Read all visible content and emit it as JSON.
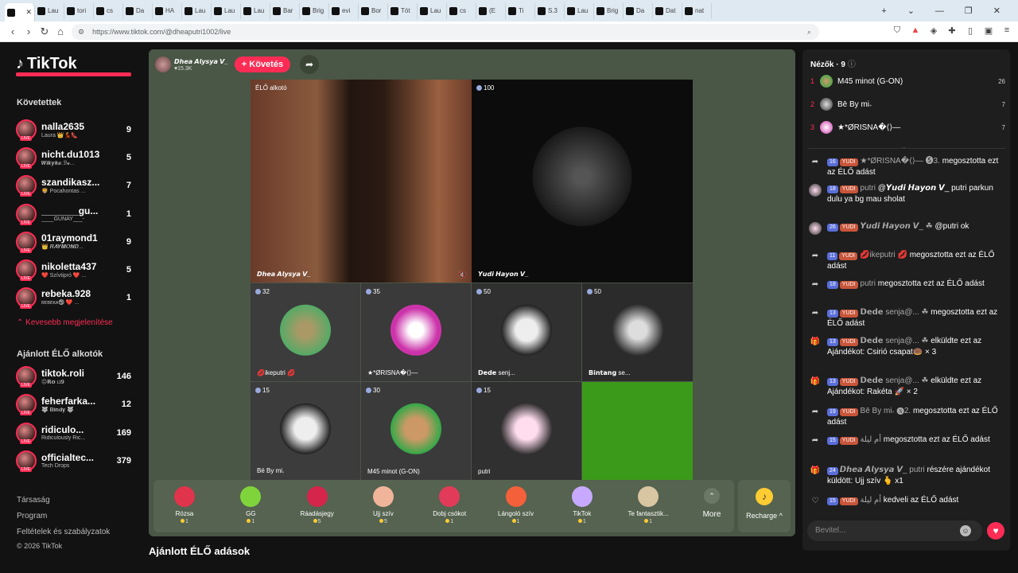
{
  "browser": {
    "tabs": [
      "",
      "Lau",
      "tori",
      "cs",
      "Da",
      "HA",
      "Lau",
      "Lau",
      "Lau",
      "Bar",
      "Brig",
      "evi",
      "Bor",
      "Tót",
      "Lau",
      "cs",
      "(E",
      "Ti",
      "S.3",
      "Lau",
      "Brig",
      "Da",
      "Dat",
      "nat"
    ],
    "url": "https://www.tiktok.com/@dheaputri1002/live"
  },
  "sidebar": {
    "logo": "TikTok",
    "following_title": "Követettek",
    "following": [
      {
        "name": "nalla2635",
        "sub": "Laura 👑💃👠",
        "count": "9"
      },
      {
        "name": "nicht.du1013",
        "sub": "𝑾𝒊𝒌𝒚𝒌𝒆.ℬ𝓮...",
        "count": "5"
      },
      {
        "name": "szandikasz...",
        "sub": "🦁 Pocahontas ...",
        "count": "7"
      },
      {
        "name": "_______gu...",
        "sub": "____GUNAY___-",
        "count": "1"
      },
      {
        "name": "01raymond1",
        "sub": "👑 𝑹𝑨𝒀𝑴𝑶𝑵𝑫...",
        "count": "9"
      },
      {
        "name": "nikoletta437",
        "sub": "❤️ Szívtipró ❤️ ...",
        "count": "5"
      },
      {
        "name": "rebeka.928",
        "sub": "ʀᴇʙᴇᴋᴀ🕲 ❤️ ...",
        "count": "1"
      }
    ],
    "show_less": "Kevesebb megjelenítése",
    "recommended_title": "Ajánlott ÉLŐ alkotók",
    "recommended": [
      {
        "name": "tiktok.roli",
        "sub": "😐𝗥𝗼 ʟɪ𝟗",
        "count": "146"
      },
      {
        "name": "feherfarka...",
        "sub": "🐺 𝐁𝐢𝐧𝐝𝐲 🐺",
        "count": "12"
      },
      {
        "name": "ridiculo...",
        "sub": "Ridiculously Ric...",
        "count": "169"
      },
      {
        "name": "officialtec...",
        "sub": "Tech Drops",
        "count": "379"
      }
    ],
    "footer": [
      "Társaság",
      "Program",
      "Feltételek és szabályzatok",
      "© 2026 TikTok"
    ]
  },
  "stage": {
    "host_name": "𝘿𝙝𝙚𝙖 𝘼𝙡𝙮𝙨𝙮𝙖 𝙑_",
    "host_likes": "♥15.3K",
    "follow_label": "+ Követés",
    "cells": [
      {
        "badge": "ÉLŐ alkotó",
        "name": "𝘿𝙝𝙚𝙖 𝘼𝙡𝙮𝙨𝙮𝙖 𝙑_"
      },
      {
        "badge": "100",
        "name": "𝙔𝙪𝙙𝙞 𝙃𝙖𝙮𝙤𝙣 𝙑_"
      },
      {
        "badge": "32",
        "name": "💋ikeputri 💋"
      },
      {
        "badge": "35",
        "name": "★*ØRISNA�⟨⟩—"
      },
      {
        "badge": "50",
        "name": "𝗗𝗲𝗱𝗲 senj..."
      },
      {
        "badge": "50",
        "name": "𝗕𝗶𝗻𝘁𝗮𝗻𝗴 se..."
      },
      {
        "badge": "15",
        "name": "Bē By mi𝆹"
      },
      {
        "badge": "30",
        "name": "M45 minot (G-ON)"
      },
      {
        "badge": "15",
        "name": "putri"
      },
      {
        "badge": "",
        "name": ""
      }
    ],
    "gifts": [
      {
        "name": "Rózsa",
        "price": "1",
        "icon": "rose-icon",
        "color": "#e0344c"
      },
      {
        "name": "GG",
        "price": "1",
        "icon": "gg-icon",
        "color": "#7fd43b"
      },
      {
        "name": "Ráadásjegy",
        "price": "5",
        "icon": "ticket-icon",
        "color": "#d5254b"
      },
      {
        "name": "Ujj szív",
        "price": "5",
        "icon": "finger-heart-icon",
        "color": "#f0b49a"
      },
      {
        "name": "Dobj csókot",
        "price": "1",
        "icon": "kiss-icon",
        "color": "#e23b5a"
      },
      {
        "name": "Lángoló szív",
        "price": "1",
        "icon": "flame-heart-icon",
        "color": "#f4603a"
      },
      {
        "name": "TikTok",
        "price": "1",
        "icon": "tiktok-icon",
        "color": "#c7a9ff"
      },
      {
        "name": "Te fantasztik...",
        "price": "1",
        "icon": "cat-icon",
        "color": "#d7c6a1"
      }
    ],
    "more_label": "More",
    "recharge_label": "Recharge ^"
  },
  "bottom_title": "Ajánlott ÉLŐ adások",
  "chat": {
    "viewers_title": "Nézők · 9",
    "viewers": [
      {
        "rank": "1",
        "name": "M45 minot (G-ON)",
        "count": "26"
      },
      {
        "rank": "2",
        "name": "Bē By mi𝆹",
        "count": "7"
      },
      {
        "rank": "3",
        "name": "★*ØRISNA�⟨⟩—",
        "count": "7"
      }
    ],
    "messages": [
      {
        "icon": "share-icon",
        "lvl": "16",
        "fan": "YUDI",
        "user": "★*ØRISNA�⟨⟩— 🅢3.",
        "text": "megosztotta ezt az ÉLŐ adást"
      },
      {
        "icon": "avatar",
        "lvl": "18",
        "fan": "YUDI",
        "user": "putri",
        "text": "@𝙔𝙪𝙙𝙞 𝙃𝙖𝙮𝙤𝙣 𝙑_ putri parkun dulu ya bg mau sholat"
      },
      {
        "icon": "avatar",
        "lvl": "26",
        "fan": "YUDI",
        "user": "𝙔𝙪𝙙𝙞 𝙃𝙖𝙮𝙤𝙣 𝙑_ ☘",
        "text": "@putri ok"
      },
      {
        "icon": "share-icon",
        "lvl": "11",
        "fan": "YUDI",
        "user": "💋ikeputri 💋",
        "text": "megosztotta ezt az ÉLŐ adást"
      },
      {
        "icon": "share-icon",
        "lvl": "18",
        "fan": "YUDI",
        "user": "putri",
        "text": "megosztotta ezt az ÉLŐ adást"
      },
      {
        "icon": "share-icon",
        "lvl": "13",
        "fan": "YUDI",
        "user": "𝗗𝗲𝗱𝗲 senja@... ☘",
        "text": "megosztotta ezt az ÉLŐ adást"
      },
      {
        "icon": "gift-icon",
        "lvl": "13",
        "fan": "YUDI",
        "user": "𝗗𝗲𝗱𝗲 senja@... ☘",
        "text": "elküldte ezt az Ajándékot: Csirió csapat🍩 × 3"
      },
      {
        "icon": "gift-icon",
        "lvl": "13",
        "fan": "YUDI",
        "user": "𝗗𝗲𝗱𝗲 senja@... ☘",
        "text": "elküldte ezt az Ajándékot: Rakéta 🚀 × 2"
      },
      {
        "icon": "share-icon",
        "lvl": "19",
        "fan": "YUDI",
        "user": "Bē By mi𝆹 🅢2.",
        "text": "megosztotta ezt az ÉLŐ adást"
      },
      {
        "icon": "share-icon",
        "lvl": "15",
        "fan": "YUDI",
        "user": "أم ليلة",
        "text": "megosztotta ezt az ÉLŐ adást"
      },
      {
        "icon": "gift-icon",
        "lvl": "24",
        "fan": "",
        "user": "𝘿𝙝𝙚𝙖 𝘼𝙡𝙮𝙨𝙮𝙖 𝙑_ putri",
        "text": "részére ajándékot küldött: Ujj szív 🫰 x1"
      },
      {
        "icon": "heart-icon",
        "lvl": "15",
        "fan": "YUDI",
        "user": "أم ليلة",
        "text": "kedveli az ÉLŐ adást"
      }
    ],
    "input_placeholder": "Bevitel..."
  }
}
